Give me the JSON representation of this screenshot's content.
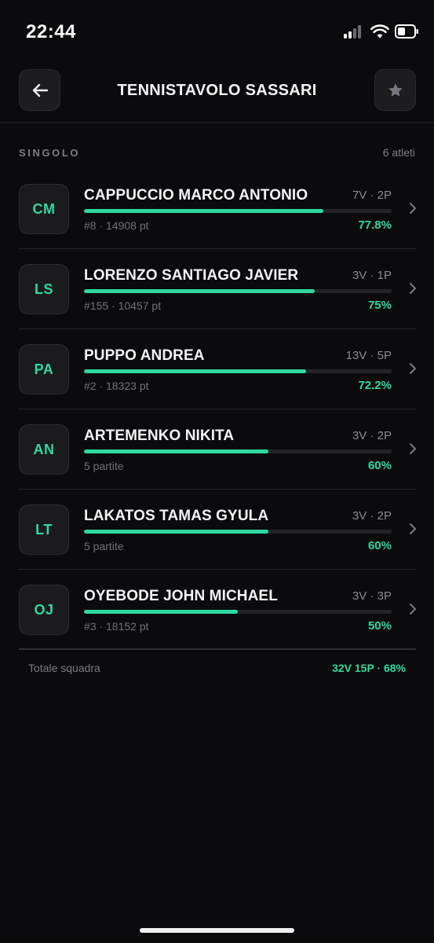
{
  "status_bar": {
    "time": "22:44"
  },
  "header": {
    "title": "TENNISTAVOLO SASSARI",
    "back_icon": "arrow-left-icon",
    "star_icon": "star-icon"
  },
  "section": {
    "title": "SINGOLO",
    "count": "6 atleti"
  },
  "players": [
    {
      "initials": "CM",
      "name": "CAPPUCCIO MARCO ANTONIO",
      "record": "7V · 2P",
      "meta": "#8 · 14908 pt",
      "pct": "77.8%",
      "win_rate": 0.778
    },
    {
      "initials": "LS",
      "name": "LORENZO SANTIAGO JAVIER",
      "record": "3V · 1P",
      "meta": "#155 · 10457 pt",
      "pct": "75%",
      "win_rate": 0.75
    },
    {
      "initials": "PA",
      "name": "PUPPO ANDREA",
      "record": "13V · 5P",
      "meta": "#2 · 18323 pt",
      "pct": "72.2%",
      "win_rate": 0.722
    },
    {
      "initials": "AN",
      "name": "ARTEMENKO NIKITA",
      "record": "3V · 2P",
      "meta": "5 partite",
      "pct": "60%",
      "win_rate": 0.6
    },
    {
      "initials": "LT",
      "name": "LAKATOS TAMAS GYULA",
      "record": "3V · 2P",
      "meta": "5 partite",
      "pct": "60%",
      "win_rate": 0.6
    },
    {
      "initials": "OJ",
      "name": "OYEBODE JOHN MICHAEL",
      "record": "3V · 3P",
      "meta": "#3 · 18152 pt",
      "pct": "50%",
      "win_rate": 0.5
    }
  ],
  "totals": {
    "label": "Totale squadra",
    "value": "32V 15P · 68%"
  },
  "colors": {
    "accent": "#2fd9a0",
    "background": "#0b0b0d",
    "card": "#1d1d20"
  }
}
